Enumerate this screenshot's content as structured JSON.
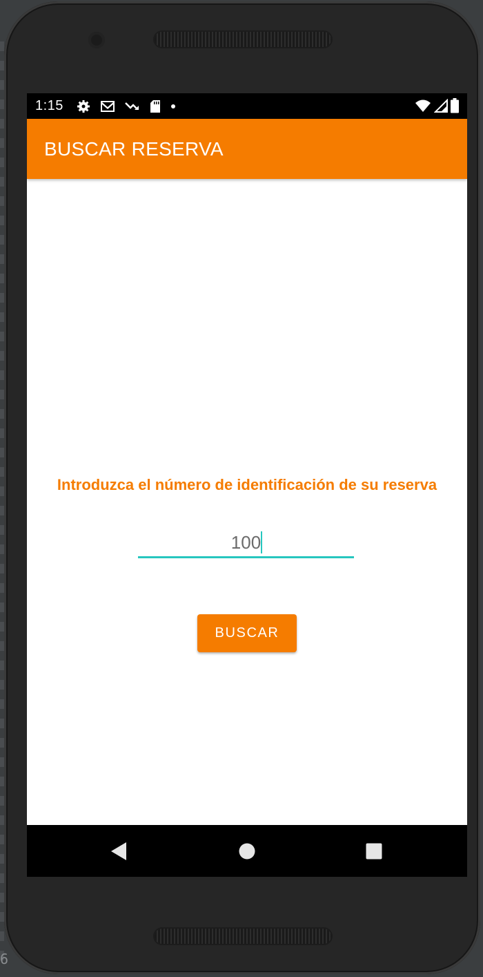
{
  "status_bar": {
    "time": "1:15",
    "left_icons": [
      "settings-icon",
      "mail-icon",
      "trending-down-icon",
      "sd-card-icon",
      "dot-icon"
    ],
    "right_icons": [
      "wifi-icon",
      "cell-signal-icon",
      "battery-icon"
    ]
  },
  "app_bar": {
    "title": "BUSCAR RESERVA"
  },
  "form": {
    "prompt": "Introduzca el número de identificación de su reserva",
    "input_value": "100",
    "search_button_label": "BUSCAR"
  },
  "nav_bar": {
    "buttons": [
      "back-icon",
      "home-icon",
      "recents-icon"
    ]
  },
  "colors": {
    "accent": "#F57C00",
    "input_underline": "#26C6BF",
    "status_bar": "#000000",
    "nav_bar": "#000000",
    "screen_bg": "#FFFFFF"
  }
}
